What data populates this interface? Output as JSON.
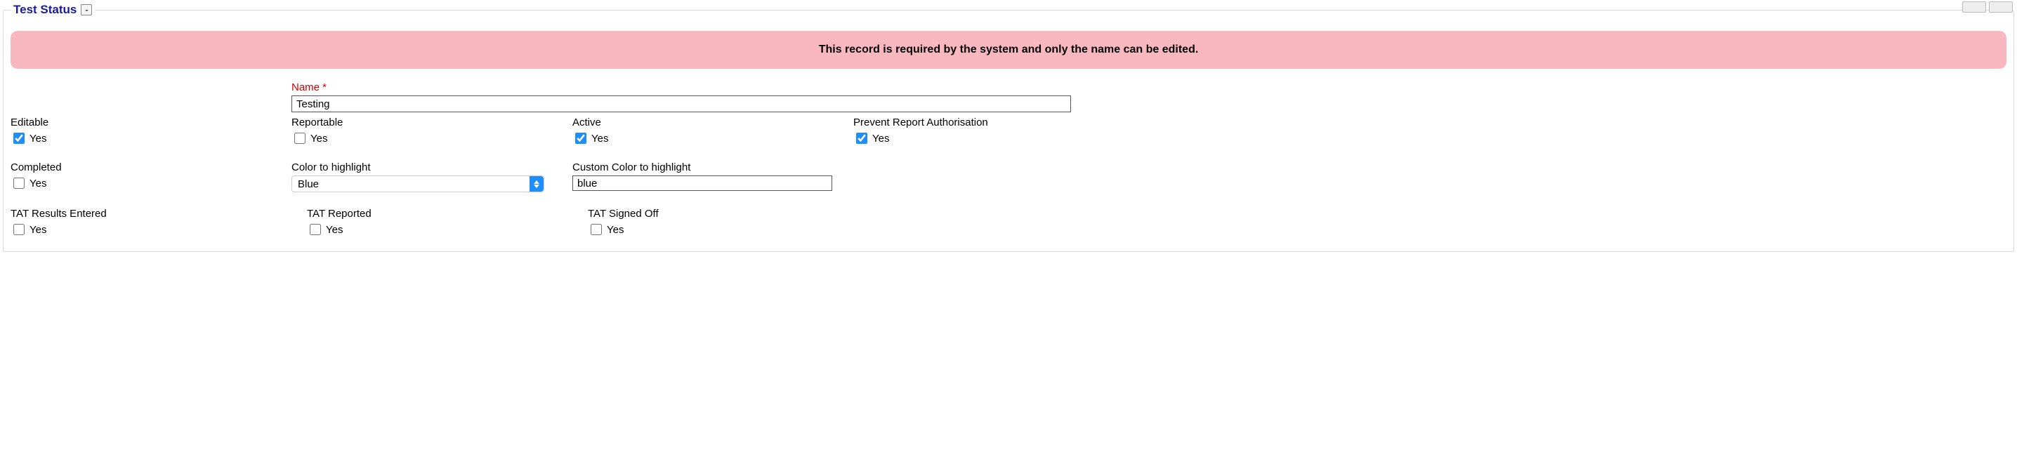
{
  "fieldset": {
    "legend": "Test Status",
    "collapse_glyph": "-"
  },
  "alert": "This record is required by the system and only the name can be edited.",
  "name": {
    "label": "Name *",
    "value": "Testing"
  },
  "row1": {
    "editable": {
      "label": "Editable",
      "checked": true,
      "option": "Yes"
    },
    "reportable": {
      "label": "Reportable",
      "checked": false,
      "option": "Yes"
    },
    "active": {
      "label": "Active",
      "checked": true,
      "option": "Yes"
    },
    "prevent": {
      "label": "Prevent Report Authorisation",
      "checked": true,
      "option": "Yes"
    }
  },
  "row2": {
    "completed": {
      "label": "Completed",
      "checked": false,
      "option": "Yes"
    },
    "color": {
      "label": "Color to highlight",
      "value": "Blue"
    },
    "custom": {
      "label": "Custom Color to highlight",
      "value": "blue"
    }
  },
  "row3": {
    "tat_entered": {
      "label": "TAT Results Entered",
      "checked": false,
      "option": "Yes"
    },
    "tat_reported": {
      "label": "TAT Reported",
      "checked": false,
      "option": "Yes"
    },
    "tat_signed": {
      "label": "TAT Signed Off",
      "checked": false,
      "option": "Yes"
    }
  }
}
